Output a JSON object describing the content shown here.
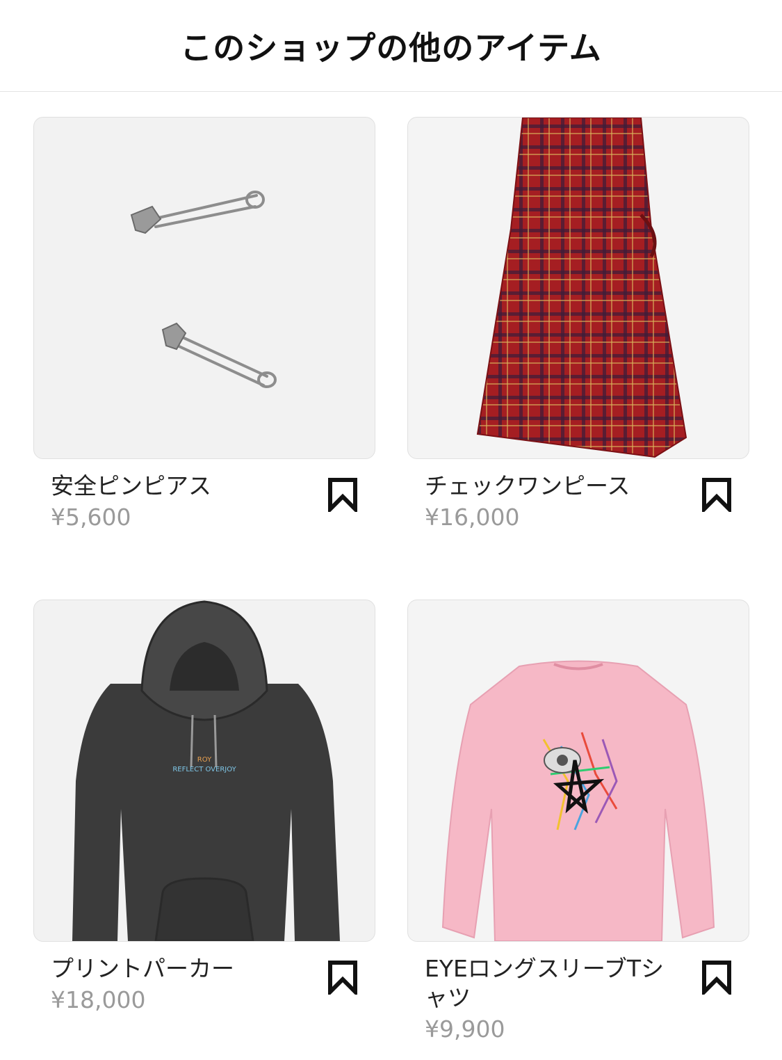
{
  "header": {
    "title": "このショップの他のアイテム"
  },
  "products": [
    {
      "name": "安全ピンピアス",
      "price": "¥5,600",
      "image_icon": "safety-pin-earrings"
    },
    {
      "name": "チェックワンピース",
      "price": "¥16,000",
      "image_icon": "plaid-wrap-dress"
    },
    {
      "name": "プリントパーカー",
      "price": "¥18,000",
      "image_icon": "print-hoodie",
      "print_line1": "ROY",
      "print_line2": "REFLECT OVERJOY"
    },
    {
      "name": "EYEロングスリーブTシャツ",
      "price": "¥9,900",
      "image_icon": "pink-long-sleeve-tee"
    }
  ],
  "colors": {
    "divider": "#e3e3e3",
    "price_text": "#9a9a9a",
    "plaid_red": "#a51e22",
    "hoodie_gray": "#3b3b3b",
    "tee_pink": "#f6b8c6"
  }
}
